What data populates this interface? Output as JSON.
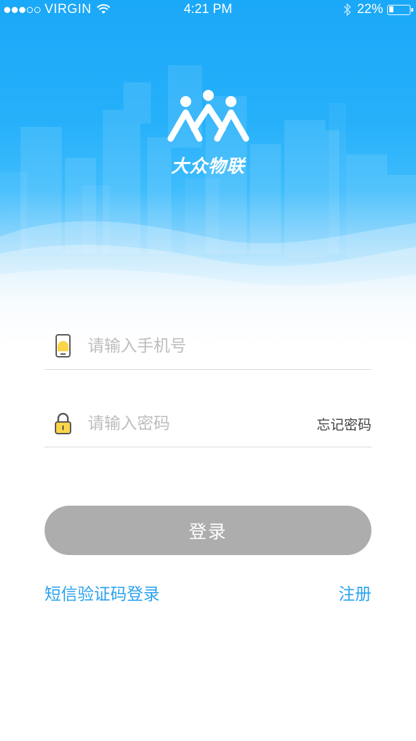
{
  "status_bar": {
    "carrier": "VIRGIN",
    "time": "4:21 PM",
    "battery_percent": "22%",
    "battery_level": 0.22,
    "signal_bars_filled": 3,
    "signal_bars_total": 5
  },
  "brand": {
    "name": "大众物联",
    "logo_icon": "three-people-logo",
    "colors": {
      "primary": "#1aa8f8",
      "link": "#2aa3ee",
      "button_disabled": "#adadad"
    }
  },
  "form": {
    "phone": {
      "placeholder": "请输入手机号",
      "value": "",
      "icon": "mobile-phone-icon"
    },
    "password": {
      "placeholder": "请输入密码",
      "value": "",
      "icon": "lock-icon"
    },
    "forgot_password": "忘记密码",
    "login_button": "登录",
    "sms_login": "短信验证码登录",
    "register": "注册"
  }
}
